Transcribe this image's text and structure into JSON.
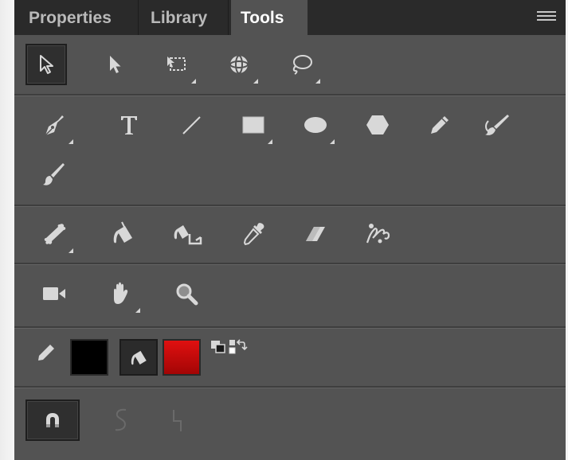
{
  "tabs": [
    {
      "label": "Properties",
      "active": false
    },
    {
      "label": "Library",
      "active": false
    },
    {
      "label": "Tools",
      "active": true
    }
  ],
  "tool_groups": {
    "selection": [
      "Selection Tool",
      "Subselection Tool",
      "Free Transform Tool",
      "3D Rotation Tool",
      "Lasso Tool"
    ],
    "drawing": [
      "Pen Tool",
      "Text Tool",
      "Line Tool",
      "Rectangle Tool",
      "Oval Tool",
      "PolyStar Tool",
      "Pencil Tool",
      "Brush Tool",
      "Paint Brush Tool"
    ],
    "editing": [
      "Bone Tool",
      "Paint Bucket Tool",
      "Width Tool",
      "Eyedropper Tool",
      "Eraser Tool",
      "Asset Warp Tool"
    ],
    "view": [
      "Camera Tool",
      "Hand Tool",
      "Zoom Tool"
    ],
    "colors": [
      "Stroke Color",
      "Fill Color",
      "Black and White",
      "Swap Colors"
    ],
    "options": [
      "Snap to Objects",
      "Smooth",
      "Straighten"
    ]
  },
  "colors": {
    "stroke": "#000000",
    "fill": "#c40a0a",
    "panel_bg": "#535353",
    "tabbar_bg": "#2a2a2a",
    "icon": "#d8d8d8"
  },
  "selected_tool": "Selection Tool",
  "selected_option": "Snap to Objects"
}
